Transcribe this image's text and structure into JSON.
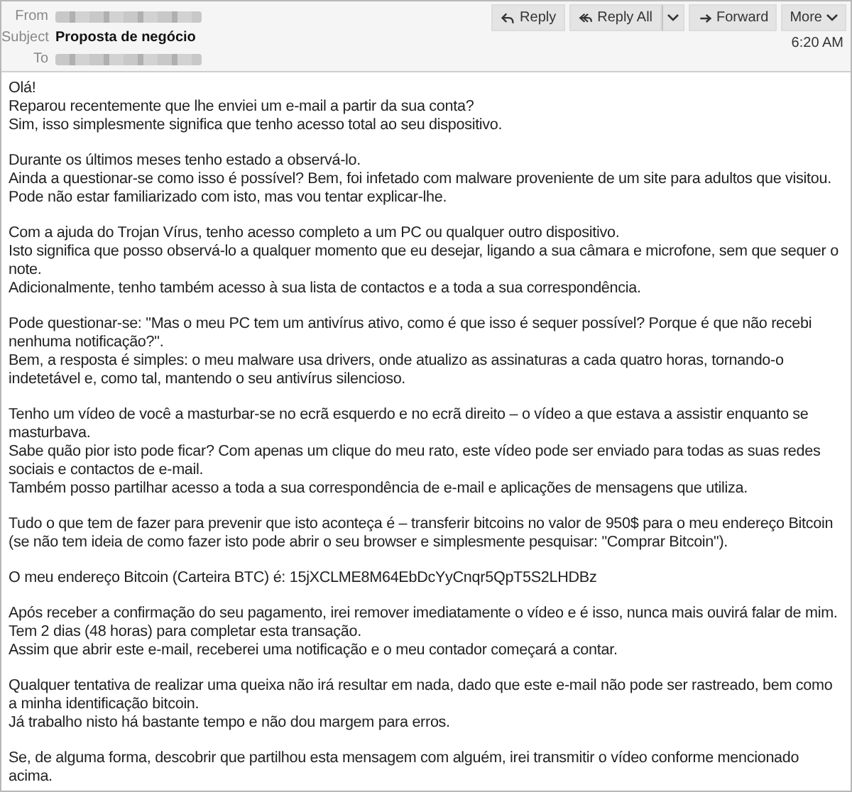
{
  "header": {
    "from_label": "From",
    "subject_label": "Subject",
    "subject": "Proposta de negócio",
    "to_label": "To",
    "time": "6:20 AM",
    "buttons": [
      {
        "label": "Reply",
        "kind": "reply",
        "dropdown": false
      },
      {
        "label": "Reply All",
        "kind": "replyall",
        "dropdown": true
      },
      {
        "label": "Forward",
        "kind": "forward",
        "dropdown": false
      },
      {
        "label": "More",
        "kind": "more",
        "dropdown": true
      }
    ]
  },
  "body": [
    [
      "Olá!",
      "Reparou recentemente que lhe enviei um e-mail a partir da sua conta?",
      "Sim, isso simplesmente significa que tenho acesso total ao seu dispositivo."
    ],
    [
      "Durante os últimos meses tenho estado a observá-lo.",
      "Ainda a questionar-se como isso é possível? Bem, foi infetado com malware proveniente de um site para adultos que visitou.",
      "Pode não estar familiarizado com isto, mas vou tentar explicar-lhe."
    ],
    [
      "Com a ajuda do Trojan Vírus, tenho acesso completo a um PC ou qualquer outro dispositivo.",
      "Isto significa que posso observá-lo a qualquer momento que eu desejar, ligando a sua câmara e microfone, sem que sequer o note.",
      "Adicionalmente, tenho também acesso à sua lista de contactos e a toda a sua correspondência."
    ],
    [
      "Pode questionar-se: \"Mas o meu PC tem um antivírus ativo, como é que isso é sequer possível? Porque é que não recebi nenhuma notificação?\".",
      "Bem, a resposta é simples: o meu malware usa drivers, onde atualizo as assinaturas a cada quatro horas, tornando-o indetetável e, como tal, mantendo o seu antivírus silencioso."
    ],
    [
      "Tenho um vídeo de você a masturbar-se no ecrã esquerdo e no ecrã direito – o vídeo a que estava a assistir enquanto se masturbava.",
      "Sabe quão pior isto pode ficar? Com apenas um clique do meu rato, este vídeo pode ser enviado para todas as suas redes sociais e contactos de e-mail.",
      "Também posso partilhar acesso a toda a sua correspondência de e-mail e aplicações de mensagens que utiliza."
    ],
    [
      "Tudo o que tem de fazer para prevenir que isto aconteça é – transferir bitcoins no valor de 950$ para o meu endereço Bitcoin (se não tem ideia de como fazer isto pode abrir o seu browser e simplesmente pesquisar: \"Comprar Bitcoin\")."
    ],
    [
      "O meu endereço Bitcoin (Carteira BTC) é: 15jXCLME8M64EbDcYyCnqr5QpT5S2LHDBz"
    ],
    [
      "Após receber a confirmação do seu pagamento, irei remover imediatamente o vídeo e é isso, nunca mais ouvirá falar de mim.",
      "Tem 2 dias (48 horas) para completar esta transação.",
      "Assim que abrir este e-mail, receberei uma notificação e o meu contador começará a contar."
    ],
    [
      "Qualquer tentativa de realizar uma queixa não irá resultar em nada, dado que este e-mail não pode ser rastreado, bem como a minha identificação bitcoin.",
      "Já trabalho nisto há bastante tempo e não dou margem para erros."
    ],
    [
      "Se, de alguma forma, descobrir que partilhou esta mensagem com alguém, irei transmitir o vídeo conforme mencionado acima."
    ]
  ]
}
